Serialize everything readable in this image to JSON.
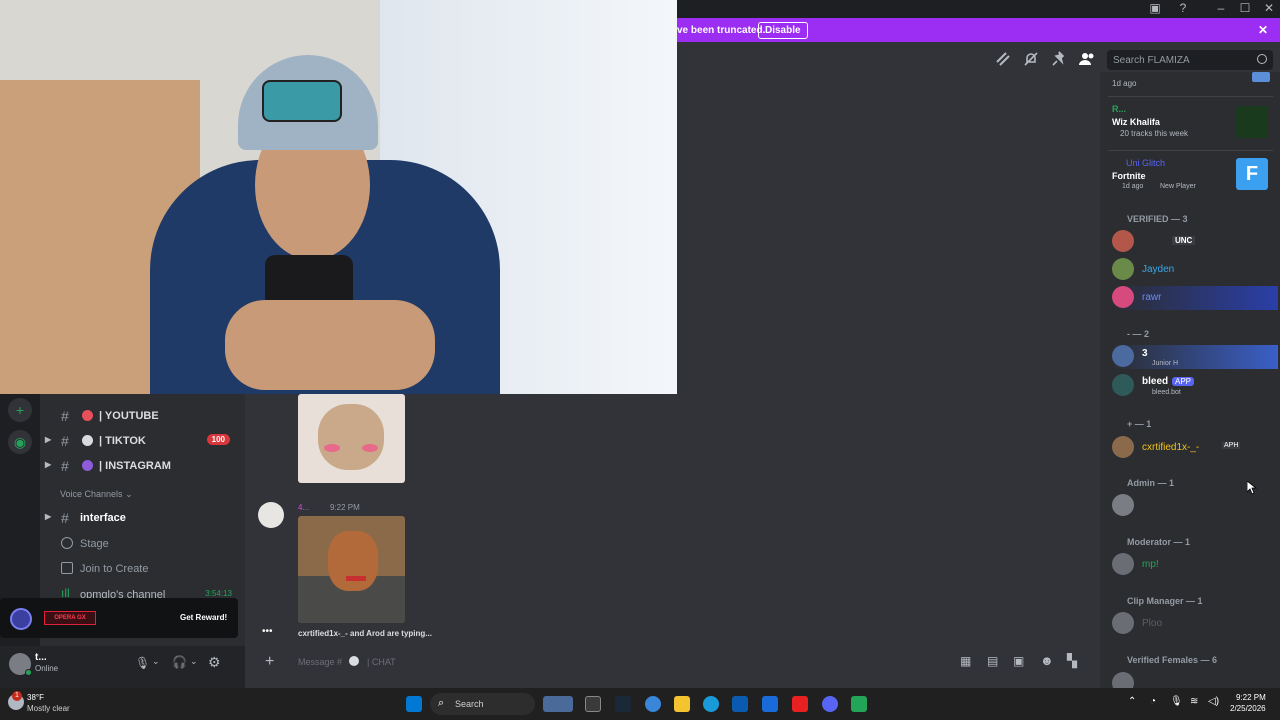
{
  "banner": {
    "text": "ve been truncated.",
    "button": "Disable"
  },
  "search": {
    "placeholder": "Search FLAMIZA"
  },
  "activity": [
    {
      "name": "",
      "title": "",
      "sub": "1d ago"
    },
    {
      "name": "R...",
      "title": "Wiz Khalifa",
      "sub": "20 tracks this week"
    },
    {
      "name": "Uni Glitch",
      "title": "Fortnite",
      "sub": "1d ago",
      "sub2": "New Player"
    }
  ],
  "members": {
    "verified_header": "VERIFIED — 3",
    "verified": [
      {
        "name": "",
        "tag": "UNC",
        "color": "#f23f43"
      },
      {
        "name": "Jayden",
        "color": "#3ba8e8"
      },
      {
        "name": "rawr",
        "color": "#6a8cf5"
      }
    ],
    "group2_header": "- — 2",
    "group2": [
      {
        "name": "3",
        "sub": "Junior H",
        "color": "#ffffff"
      },
      {
        "name": "bleed",
        "tag": "APP",
        "sub": "bleed.bot",
        "color": "#ffffff"
      }
    ],
    "group3_header": "+ — 1",
    "group3": [
      {
        "name": "cxrtified1x-_-",
        "tag": "APH",
        "color": "#f0c419"
      }
    ],
    "admin_header": "Admin — 1",
    "mod_header": "Moderator — 1",
    "mod_member": "mp!",
    "clip_header": "Clip Manager — 1",
    "clip_member": "Ploo",
    "females_header": "Verified Females — 6"
  },
  "channels": [
    {
      "name": "| YOUTUBE",
      "dot": "#e8505b"
    },
    {
      "name": "| TIKTOK",
      "dot": "#d9d9e0",
      "badge": "100"
    },
    {
      "name": "| INSTAGRAM",
      "dot": "#8e5bd9"
    }
  ],
  "voice_header": "Voice Channels",
  "voice": [
    {
      "name": "interface",
      "kind": "text"
    },
    {
      "name": "Stage",
      "kind": "stage"
    },
    {
      "name": "Join to Create",
      "kind": "voice"
    },
    {
      "name": "opmglo's channel",
      "kind": "live",
      "timer": "3:54:13"
    }
  ],
  "reward": {
    "logo": "OPERA GX",
    "button": "Get Reward!"
  },
  "user": {
    "name": "t...",
    "status": "Online"
  },
  "messages": {
    "time": "9:22 PM",
    "author": "4...",
    "typing": "cxrtified1x-_- and Arod are typing..."
  },
  "input": {
    "placeholder": "Message #",
    "channel": "| CHAT"
  },
  "taskbar": {
    "weather_temp": "38°F",
    "weather_desc": "Mostly clear",
    "search": "Search",
    "time": "9:22 PM",
    "date": "2/25/2026",
    "notif_count": "1"
  }
}
